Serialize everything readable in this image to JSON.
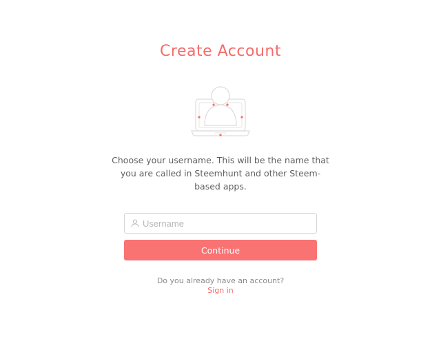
{
  "page": {
    "title": "Create Account",
    "description": "Choose your username. This will be the name that you are called in Steemhunt and other Steem-based apps."
  },
  "form": {
    "username": {
      "placeholder": "Username",
      "value": "",
      "icon": "user-icon"
    },
    "continue_label": "Continue"
  },
  "footer": {
    "question": "Do you already have an account?",
    "signin_label": "Sign in"
  },
  "colors": {
    "accent": "#f36c6a",
    "button": "#f97372",
    "text": "#5f5f5f",
    "muted": "#8a8a8a",
    "border": "#d6d6d6"
  },
  "illustration": {
    "icon": "laptop-user-icon"
  }
}
